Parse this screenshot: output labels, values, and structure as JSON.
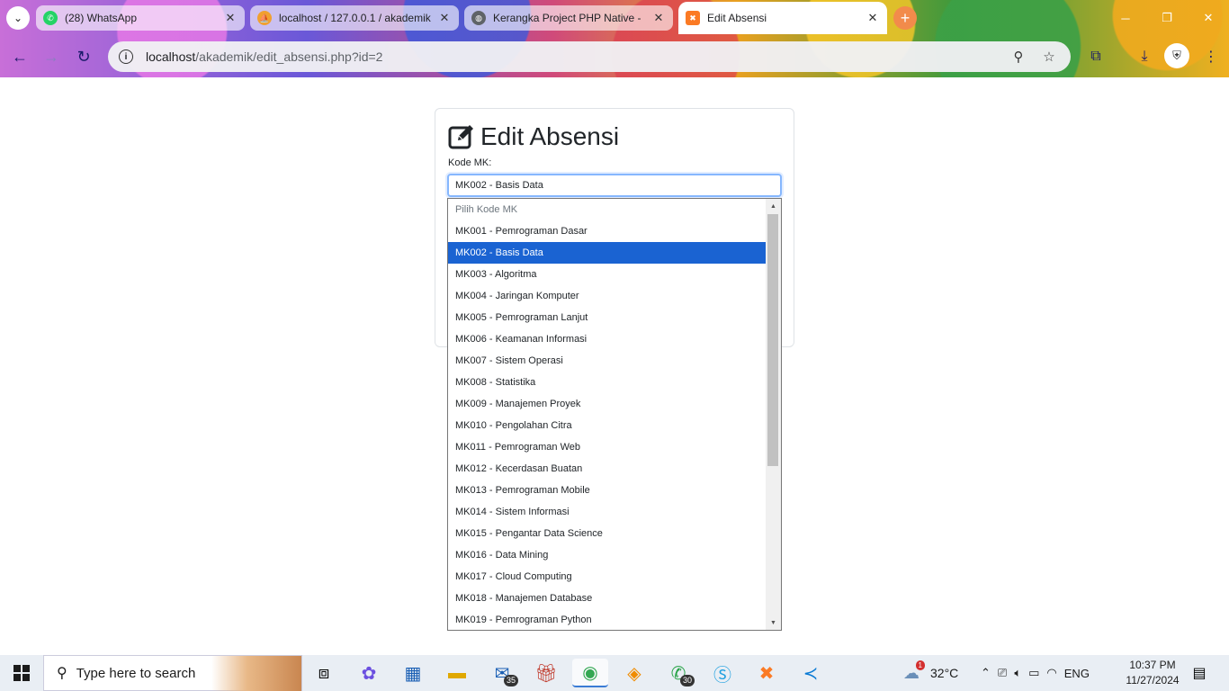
{
  "browser": {
    "tabs": [
      {
        "title": "(28) WhatsApp",
        "favicon": "whatsapp-icon"
      },
      {
        "title": "localhost / 127.0.0.1 / akademik",
        "favicon": "phpmyadmin-icon"
      },
      {
        "title": "Kerangka Project PHP Native - ",
        "favicon": "globe-icon"
      },
      {
        "title": "Edit Absensi",
        "favicon": "xampp-icon"
      }
    ],
    "url_host": "localhost",
    "url_path": "/akademik/edit_absensi.php?id=2"
  },
  "page": {
    "title": "Edit Absensi",
    "field_label": "Kode MK:",
    "selected_value": "MK002 - Basis Data",
    "placeholder_option": "Pilih Kode MK",
    "options": [
      "MK001 - Pemrograman Dasar",
      "MK002 - Basis Data",
      "MK003 - Algoritma",
      "MK004 - Jaringan Komputer",
      "MK005 - Pemrograman Lanjut",
      "MK006 - Keamanan Informasi",
      "MK007 - Sistem Operasi",
      "MK008 - Statistika",
      "MK009 - Manajemen Proyek",
      "MK010 - Pengolahan Citra",
      "MK011 - Pemrograman Web",
      "MK012 - Kecerdasan Buatan",
      "MK013 - Pemrograman Mobile",
      "MK014 - Sistem Informasi",
      "MK015 - Pengantar Data Science",
      "MK016 - Data Mining",
      "MK017 - Cloud Computing",
      "MK018 - Manajemen Database",
      "MK019 - Pemrograman Python"
    ],
    "selected_index": 1
  },
  "taskbar": {
    "search_placeholder": "Type here to search",
    "mail_badge": "35",
    "whatsapp_badge": "30",
    "weather_badge": "1",
    "temperature": "32°C",
    "language": "ENG",
    "time": "10:37 PM",
    "date": "11/27/2024"
  },
  "colors": {
    "select_highlight": "#1a63d2",
    "focus_border": "#86b7fe"
  }
}
